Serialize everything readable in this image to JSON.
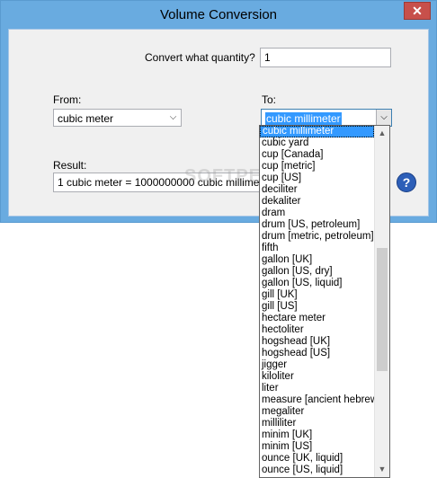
{
  "window": {
    "title": "Volume Conversion",
    "close_label": "✕"
  },
  "quantity": {
    "label": "Convert what quantity?",
    "value": "1"
  },
  "from": {
    "label": "From:",
    "value": "cubic meter"
  },
  "to": {
    "label": "To:",
    "value": "cubic millimeter"
  },
  "result": {
    "label": "Result:",
    "value": "1 cubic meter = 1000000000 cubic millimeter"
  },
  "help": {
    "label": "?"
  },
  "watermark": "SOFTPEDIA",
  "dropdown": {
    "items": [
      "cubic millimeter",
      "cubic yard",
      "cup [Canada]",
      "cup [metric]",
      "cup [US]",
      "deciliter",
      "dekaliter",
      "dram",
      "drum [US, petroleum]",
      "drum [metric, petroleum]",
      "fifth",
      "gallon [UK]",
      "gallon [US, dry]",
      "gallon [US, liquid]",
      "gill [UK]",
      "gill [US]",
      "hectare meter",
      "hectoliter",
      "hogshead [UK]",
      "hogshead [US]",
      "jigger",
      "kiloliter",
      "liter",
      "measure [ancient hebrew]",
      "megaliter",
      "milliliter",
      "minim [UK]",
      "minim [US]",
      "ounce [UK, liquid]",
      "ounce [US, liquid]"
    ],
    "selected_index": 0
  }
}
